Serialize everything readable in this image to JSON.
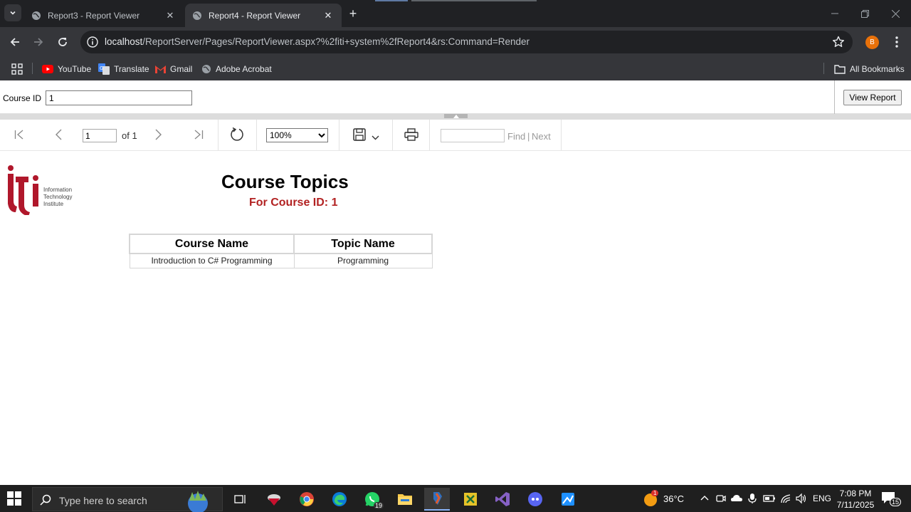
{
  "browser": {
    "tabs": [
      {
        "title": "Report3 - Report Viewer",
        "active": false
      },
      {
        "title": "Report4 - Report Viewer",
        "active": true
      }
    ],
    "url_host": "localhost",
    "url_rest": "/ReportServer/Pages/ReportViewer.aspx?%2fiti+system%2fReport4&rs:Command=Render",
    "profile_initial": "B",
    "bookmarks": [
      "YouTube",
      "Translate",
      "Gmail",
      "Adobe Acrobat"
    ],
    "all_bookmarks": "All Bookmarks"
  },
  "params": {
    "label": "Course ID",
    "value": "1",
    "view_button": "View Report"
  },
  "viewer": {
    "page_value": "1",
    "of_label": "of 1",
    "zoom": "100%",
    "find_label": "Find",
    "find_sep": "|",
    "next_label": "Next"
  },
  "report": {
    "logo_text": [
      "Information",
      "Technology",
      "Institute"
    ],
    "title": "Course Topics",
    "subtitle": "For Course ID: 1",
    "columns": [
      "Course Name",
      "Topic Name"
    ],
    "rows": [
      [
        "Introduction to C# Programming",
        "Programming"
      ]
    ]
  },
  "taskbar": {
    "search_placeholder": "Type here to search",
    "weather": "36°C",
    "weather_badge": "1",
    "language": "ENG",
    "time": "7:08 PM",
    "date": "7/11/2025",
    "notifications": "15",
    "whatsapp_badge": "19"
  },
  "colors": {
    "accent_red": "#b22222",
    "chrome_dark": "#202124",
    "chrome_mid": "#35363a",
    "profile_orange": "#e8710a"
  }
}
